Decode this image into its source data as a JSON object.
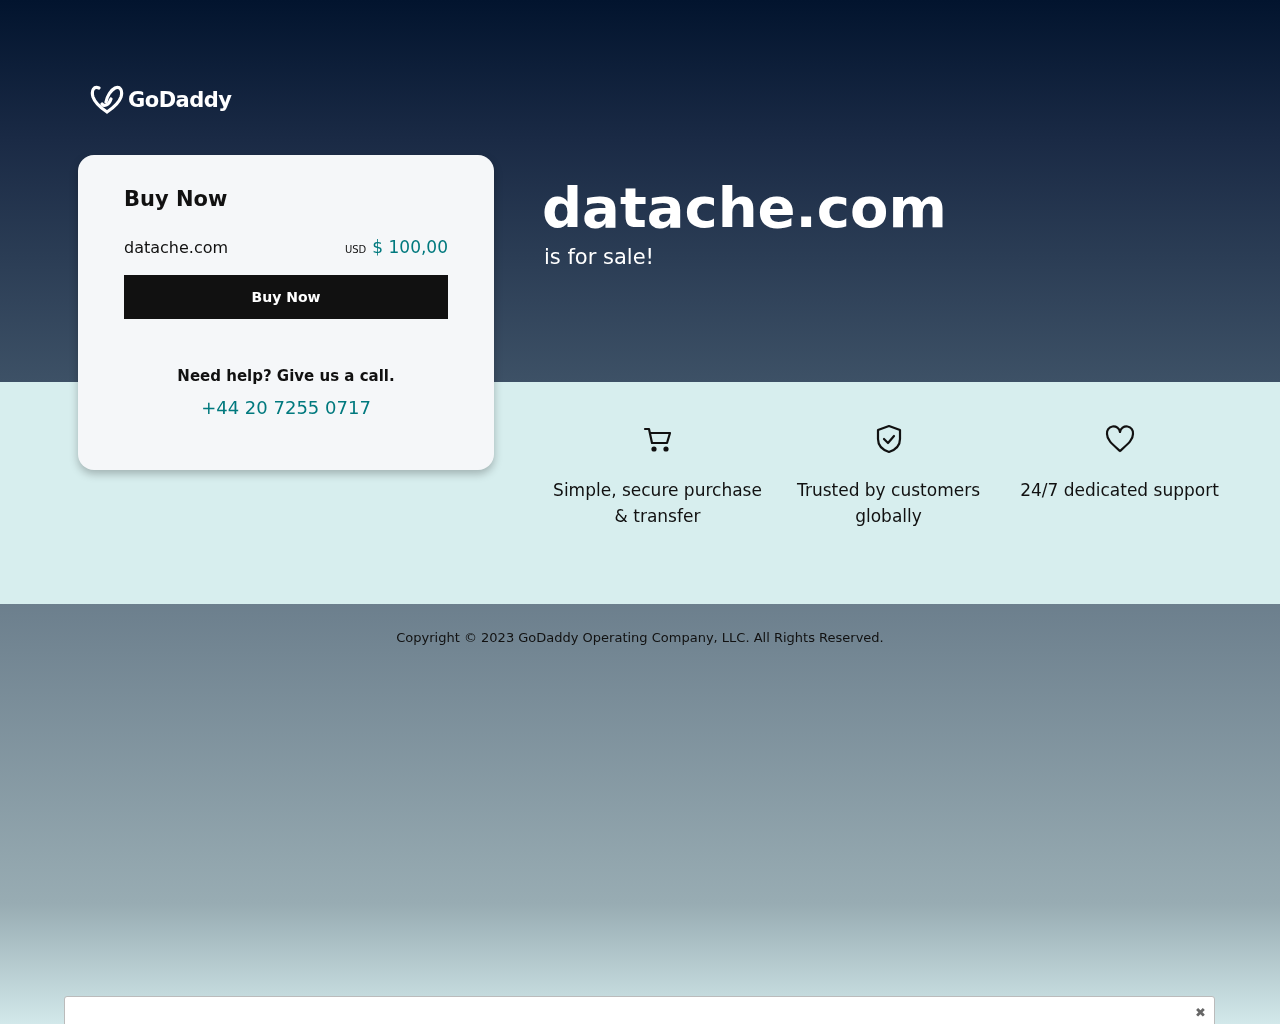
{
  "logo": {
    "text": "GoDaddy"
  },
  "card": {
    "title": "Buy Now",
    "domain": "datache.com",
    "currency": "USD",
    "price": "$ 100,00",
    "button": "Buy Now",
    "help": "Need help? Give us a call.",
    "phone": "+44 20 7255 0717"
  },
  "hero": {
    "domain": "datache.com",
    "subtitle": "is for sale!"
  },
  "features": [
    {
      "kind": "cart",
      "text": "Simple, secure purchase & transfer"
    },
    {
      "kind": "shield",
      "text": "Trusted by customers globally"
    },
    {
      "kind": "heart",
      "text": "24/7 dedicated support"
    }
  ],
  "footer": {
    "copyright": "Copyright © 2023 GoDaddy Operating Company, LLC. All Rights Reserved."
  },
  "banner": {
    "close": "✖"
  }
}
